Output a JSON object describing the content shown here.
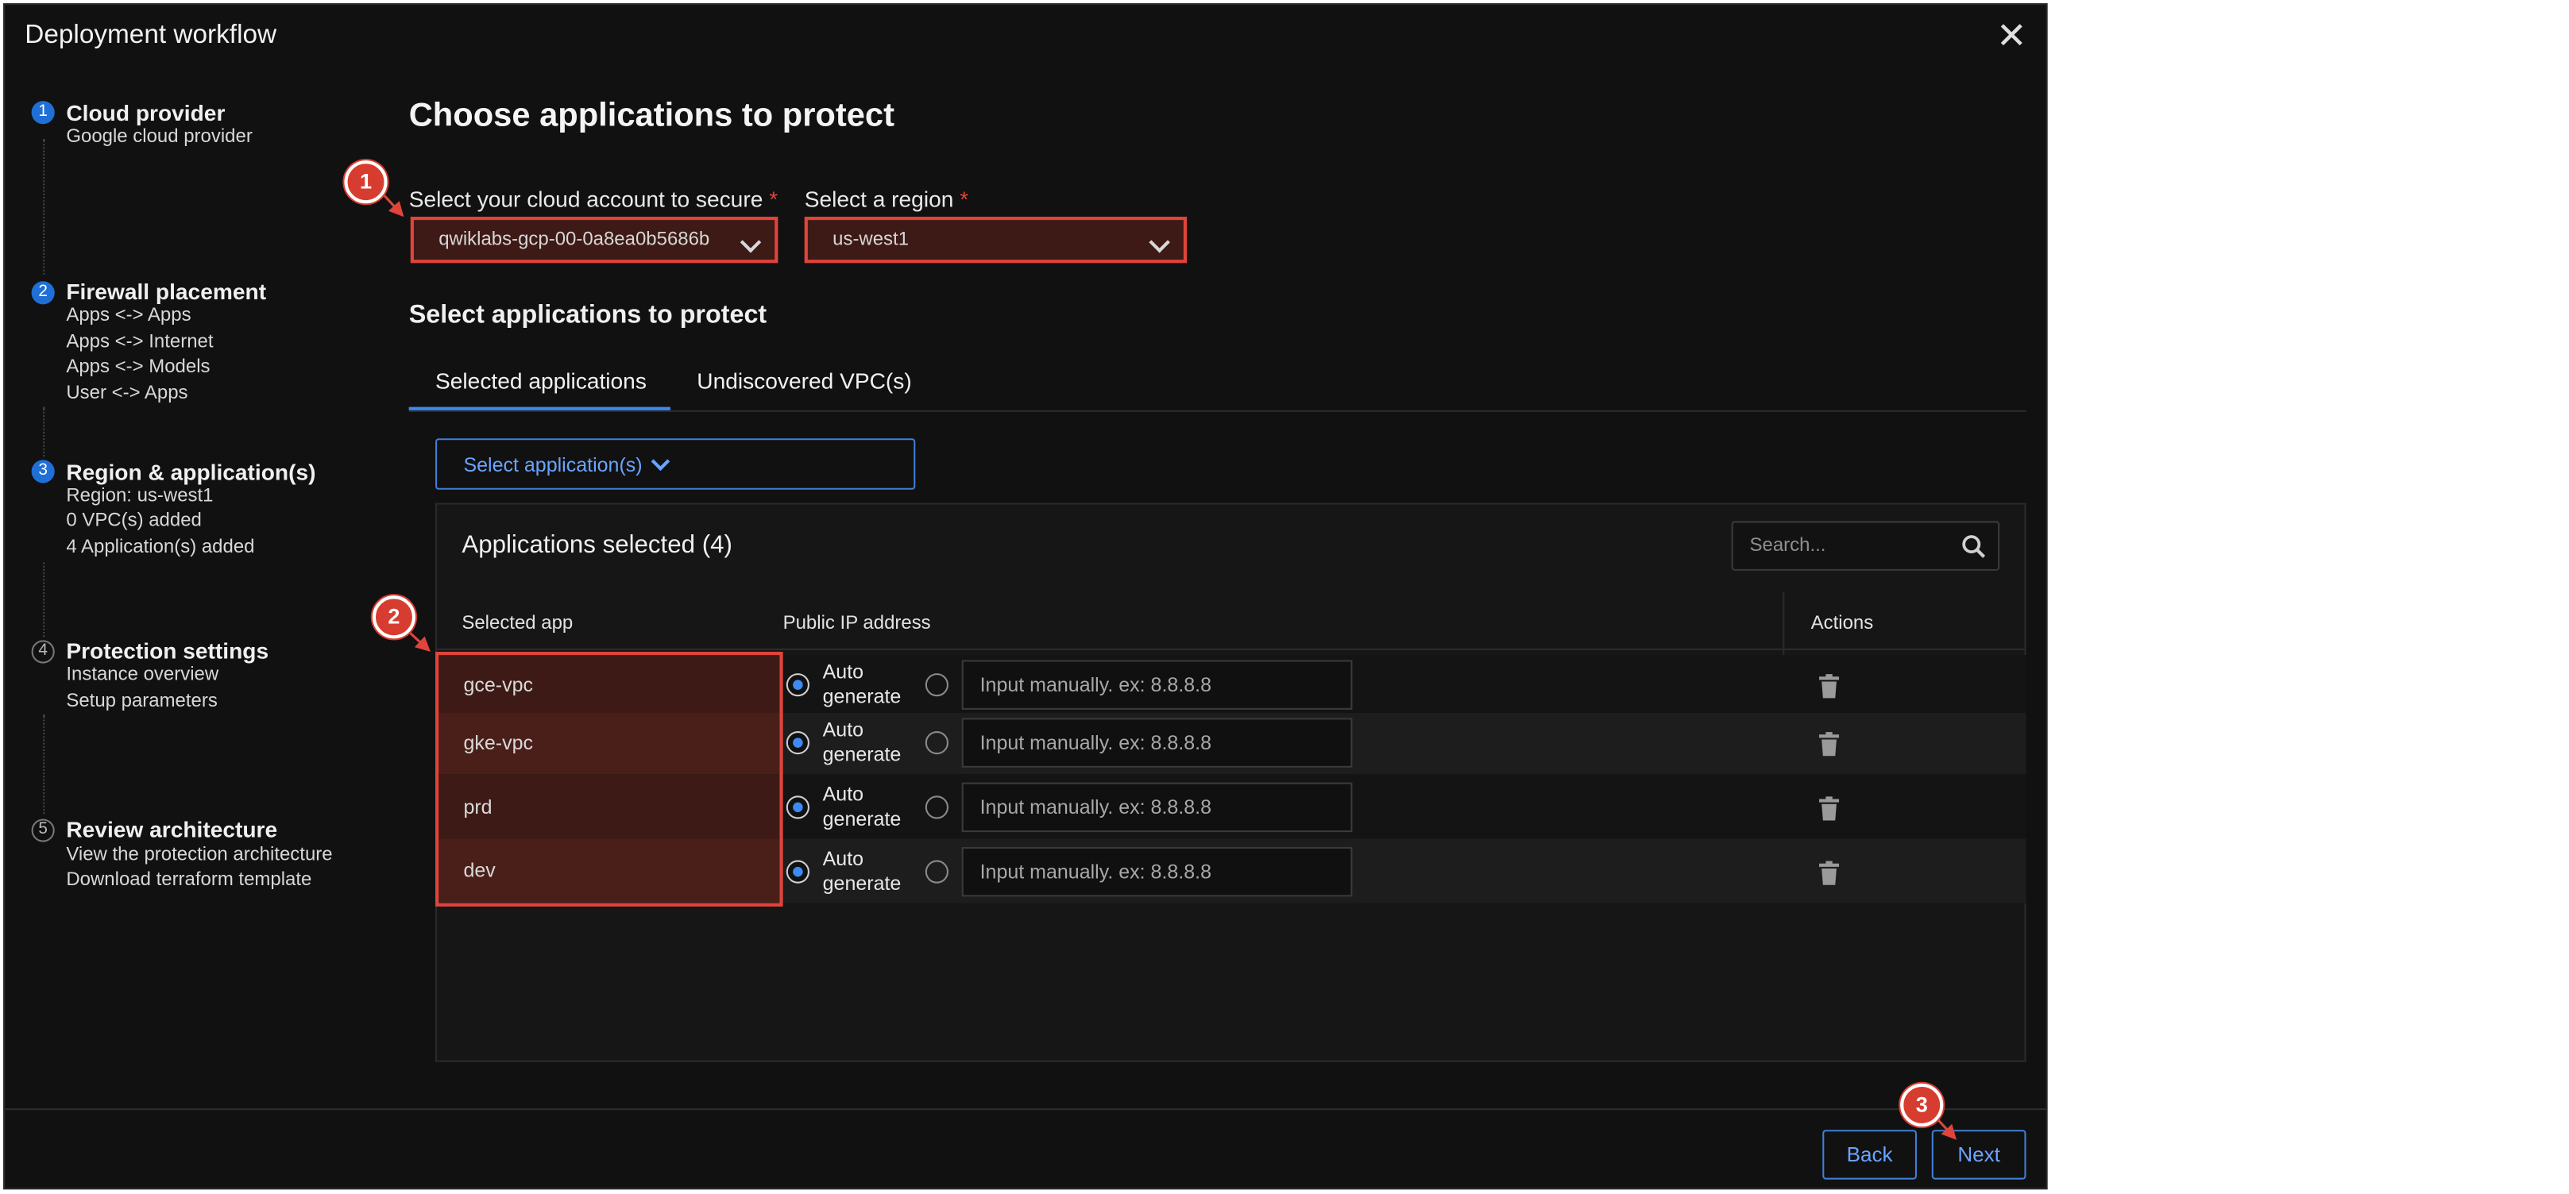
{
  "modal": {
    "title": "Deployment workflow"
  },
  "steps": [
    {
      "number": "1",
      "title": "Cloud provider",
      "lines": [
        "Google cloud provider"
      ]
    },
    {
      "number": "2",
      "title": "Firewall placement",
      "lines": [
        "Apps <-> Apps",
        "Apps <-> Internet",
        "Apps <-> Models",
        "User <-> Apps"
      ]
    },
    {
      "number": "3",
      "title": "Region & application(s)",
      "lines": [
        "Region: us-west1",
        "0 VPC(s) added",
        "4 Application(s) added"
      ]
    },
    {
      "number": "4",
      "title": "Protection settings",
      "lines": [
        "Instance overview",
        "Setup parameters"
      ]
    },
    {
      "number": "5",
      "title": "Review architecture",
      "lines": [
        "View the protection architecture",
        "Download terraform template"
      ]
    }
  ],
  "main": {
    "heading": "Choose applications to protect",
    "account": {
      "label": "Select your cloud account to secure",
      "required_mark": "*",
      "value": "qwiklabs-gcp-00-0a8ea0b5686b"
    },
    "region": {
      "label": "Select a region",
      "required_mark": "*",
      "value": "us-west1"
    },
    "subheading": "Select applications to protect",
    "tabs": [
      {
        "label": "Selected applications",
        "active": true
      },
      {
        "label": "Undiscovered VPC(s)",
        "active": false
      }
    ],
    "select_apps_button": "Select application(s)",
    "panel": {
      "title": "Applications selected (4)",
      "search_placeholder": "Search...",
      "columns": {
        "app": "Selected app",
        "ip": "Public IP address",
        "actions": "Actions"
      },
      "auto_label_1": "Auto",
      "auto_label_2": "generate",
      "ip_placeholder": "Input manually. ex: 8.8.8.8",
      "rows": [
        {
          "app": "gce-vpc"
        },
        {
          "app": "gke-vpc"
        },
        {
          "app": "prd"
        },
        {
          "app": "dev"
        }
      ]
    }
  },
  "footer": {
    "back": "Back",
    "next": "Next"
  },
  "annotations": [
    "1",
    "2",
    "3"
  ],
  "colors": {
    "accent": "#3d8bf2",
    "highlight": "#e0443a",
    "background": "#111111"
  },
  "icons": [
    "close-icon",
    "chevron-down-icon",
    "search-icon",
    "trash-icon"
  ]
}
